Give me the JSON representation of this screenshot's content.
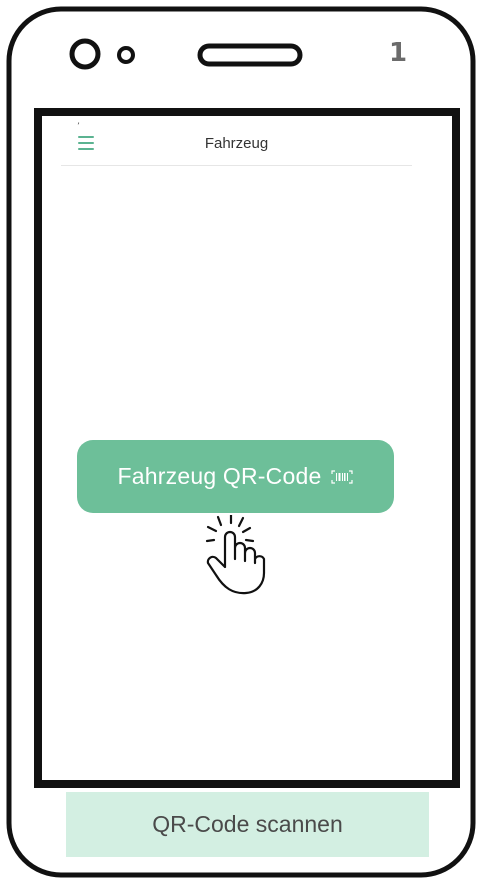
{
  "step": {
    "number": "1"
  },
  "app": {
    "header_title": "Fahrzeug",
    "menu_icon": "hamburger-menu-icon",
    "tiny_glyph": "ʼ"
  },
  "main": {
    "qr_button_label": "Fahrzeug QR-Code",
    "qr_button_icon": "barcode-scan-icon",
    "pointer_icon": "tap-hand-icon"
  },
  "caption": {
    "text": "QR-Code scannen"
  },
  "colors": {
    "accent": "#6dbf99",
    "caption_bg": "#d3efe2",
    "menu": "#5bb391",
    "outline": "#111111"
  }
}
